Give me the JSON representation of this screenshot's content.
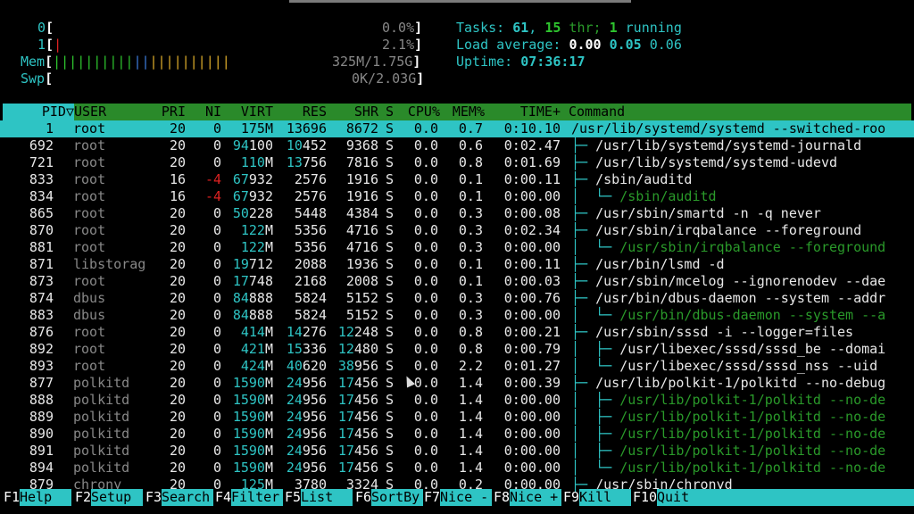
{
  "meters": {
    "cpu0": {
      "label": "0",
      "value": "0.0%"
    },
    "cpu1": {
      "label": "1",
      "value": "2.1%"
    },
    "mem": {
      "label": "Mem",
      "value": "325M/1.75G",
      "bar": "||||||||||||||||||||"
    },
    "swp": {
      "label": "Swp",
      "value": "0K/2.03G"
    }
  },
  "summary": {
    "tasks_label": "Tasks: ",
    "tasks": "61",
    "thr_count": "15",
    "thr_label": " thr; ",
    "running": "1",
    "running_label": " running",
    "load_label": "Load average: ",
    "load1": "0.00",
    "load5": "0.05",
    "load15": "0.06",
    "uptime_label": "Uptime: ",
    "uptime": "07:36:17"
  },
  "columns": {
    "pid": "PID▽",
    "user": "USER",
    "pri": "PRI",
    "ni": "NI",
    "virt": "VIRT",
    "res": "RES",
    "shr": "SHR",
    "s": "S",
    "cpu": "CPU%",
    "mem": "MEM%",
    "time": "TIME+",
    "cmd": "Command"
  },
  "processes": [
    {
      "pid": "1",
      "user": "root",
      "pri": "20",
      "ni": "0",
      "virt": "175M",
      "res": "13696",
      "shr": "8672",
      "s": "S",
      "cpu": "0.0",
      "mem": "0.7",
      "time": "0:10.10",
      "tree": "",
      "cmd": "/usr/lib/systemd/systemd --switched-roo",
      "thread": false
    },
    {
      "pid": "692",
      "user": "root",
      "pri": "20",
      "ni": "0",
      "virt": "94100",
      "res": "10452",
      "shr": "9368",
      "s": "S",
      "cpu": "0.0",
      "mem": "0.6",
      "time": "0:02.47",
      "tree": "├─ ",
      "cmd": "/usr/lib/systemd/systemd-journald",
      "thread": false
    },
    {
      "pid": "721",
      "user": "root",
      "pri": "20",
      "ni": "0",
      "virt": "110M",
      "res": "13756",
      "shr": "7816",
      "s": "S",
      "cpu": "0.0",
      "mem": "0.8",
      "time": "0:01.69",
      "tree": "├─ ",
      "cmd": "/usr/lib/systemd/systemd-udevd",
      "thread": false
    },
    {
      "pid": "833",
      "user": "root",
      "pri": "16",
      "ni": "-4",
      "virt": "67932",
      "res": "2576",
      "shr": "1916",
      "s": "S",
      "cpu": "0.0",
      "mem": "0.1",
      "time": "0:00.11",
      "tree": "├─ ",
      "cmd": "/sbin/auditd",
      "thread": false
    },
    {
      "pid": "834",
      "user": "root",
      "pri": "16",
      "ni": "-4",
      "virt": "67932",
      "res": "2576",
      "shr": "1916",
      "s": "S",
      "cpu": "0.0",
      "mem": "0.1",
      "time": "0:00.00",
      "tree": "│  └─ ",
      "cmd": "/sbin/auditd",
      "thread": true
    },
    {
      "pid": "865",
      "user": "root",
      "pri": "20",
      "ni": "0",
      "virt": "50228",
      "res": "5448",
      "shr": "4384",
      "s": "S",
      "cpu": "0.0",
      "mem": "0.3",
      "time": "0:00.08",
      "tree": "├─ ",
      "cmd": "/usr/sbin/smartd -n -q never",
      "thread": false
    },
    {
      "pid": "870",
      "user": "root",
      "pri": "20",
      "ni": "0",
      "virt": "122M",
      "res": "5356",
      "shr": "4716",
      "s": "S",
      "cpu": "0.0",
      "mem": "0.3",
      "time": "0:02.34",
      "tree": "├─ ",
      "cmd": "/usr/sbin/irqbalance --foreground",
      "thread": false
    },
    {
      "pid": "881",
      "user": "root",
      "pri": "20",
      "ni": "0",
      "virt": "122M",
      "res": "5356",
      "shr": "4716",
      "s": "S",
      "cpu": "0.0",
      "mem": "0.3",
      "time": "0:00.00",
      "tree": "│  └─ ",
      "cmd": "/usr/sbin/irqbalance --foreground",
      "thread": true
    },
    {
      "pid": "871",
      "user": "libstorag",
      "pri": "20",
      "ni": "0",
      "virt": "19712",
      "res": "2088",
      "shr": "1936",
      "s": "S",
      "cpu": "0.0",
      "mem": "0.1",
      "time": "0:00.11",
      "tree": "├─ ",
      "cmd": "/usr/bin/lsmd -d",
      "thread": false
    },
    {
      "pid": "873",
      "user": "root",
      "pri": "20",
      "ni": "0",
      "virt": "17748",
      "res": "2168",
      "shr": "2008",
      "s": "S",
      "cpu": "0.0",
      "mem": "0.1",
      "time": "0:00.03",
      "tree": "├─ ",
      "cmd": "/usr/sbin/mcelog --ignorenodev --dae",
      "thread": false
    },
    {
      "pid": "874",
      "user": "dbus",
      "pri": "20",
      "ni": "0",
      "virt": "84888",
      "res": "5824",
      "shr": "5152",
      "s": "S",
      "cpu": "0.0",
      "mem": "0.3",
      "time": "0:00.76",
      "tree": "├─ ",
      "cmd": "/usr/bin/dbus-daemon --system --addr",
      "thread": false
    },
    {
      "pid": "883",
      "user": "dbus",
      "pri": "20",
      "ni": "0",
      "virt": "84888",
      "res": "5824",
      "shr": "5152",
      "s": "S",
      "cpu": "0.0",
      "mem": "0.3",
      "time": "0:00.00",
      "tree": "│  └─ ",
      "cmd": "/usr/bin/dbus-daemon --system --a",
      "thread": true
    },
    {
      "pid": "876",
      "user": "root",
      "pri": "20",
      "ni": "0",
      "virt": "414M",
      "res": "14276",
      "shr": "12248",
      "s": "S",
      "cpu": "0.0",
      "mem": "0.8",
      "time": "0:00.21",
      "tree": "├─ ",
      "cmd": "/usr/sbin/sssd -i --logger=files",
      "thread": false
    },
    {
      "pid": "892",
      "user": "root",
      "pri": "20",
      "ni": "0",
      "virt": "421M",
      "res": "15336",
      "shr": "12480",
      "s": "S",
      "cpu": "0.0",
      "mem": "0.8",
      "time": "0:00.79",
      "tree": "│  ├─ ",
      "cmd": "/usr/libexec/sssd/sssd_be --domai",
      "thread": false
    },
    {
      "pid": "893",
      "user": "root",
      "pri": "20",
      "ni": "0",
      "virt": "424M",
      "res": "40620",
      "shr": "38956",
      "s": "S",
      "cpu": "0.0",
      "mem": "2.2",
      "time": "0:01.27",
      "tree": "│  └─ ",
      "cmd": "/usr/libexec/sssd/sssd_nss --uid",
      "thread": false
    },
    {
      "pid": "877",
      "user": "polkitd",
      "pri": "20",
      "ni": "0",
      "virt": "1590M",
      "res": "24956",
      "shr": "17456",
      "s": "S",
      "cpu": "0.0",
      "mem": "1.4",
      "time": "0:00.39",
      "tree": "├─ ",
      "cmd": "/usr/lib/polkit-1/polkitd --no-debug",
      "thread": false
    },
    {
      "pid": "888",
      "user": "polkitd",
      "pri": "20",
      "ni": "0",
      "virt": "1590M",
      "res": "24956",
      "shr": "17456",
      "s": "S",
      "cpu": "0.0",
      "mem": "1.4",
      "time": "0:00.00",
      "tree": "│  ├─ ",
      "cmd": "/usr/lib/polkit-1/polkitd --no-de",
      "thread": true
    },
    {
      "pid": "889",
      "user": "polkitd",
      "pri": "20",
      "ni": "0",
      "virt": "1590M",
      "res": "24956",
      "shr": "17456",
      "s": "S",
      "cpu": "0.0",
      "mem": "1.4",
      "time": "0:00.00",
      "tree": "│  ├─ ",
      "cmd": "/usr/lib/polkit-1/polkitd --no-de",
      "thread": true
    },
    {
      "pid": "890",
      "user": "polkitd",
      "pri": "20",
      "ni": "0",
      "virt": "1590M",
      "res": "24956",
      "shr": "17456",
      "s": "S",
      "cpu": "0.0",
      "mem": "1.4",
      "time": "0:00.00",
      "tree": "│  ├─ ",
      "cmd": "/usr/lib/polkit-1/polkitd --no-de",
      "thread": true
    },
    {
      "pid": "891",
      "user": "polkitd",
      "pri": "20",
      "ni": "0",
      "virt": "1590M",
      "res": "24956",
      "shr": "17456",
      "s": "S",
      "cpu": "0.0",
      "mem": "1.4",
      "time": "0:00.00",
      "tree": "│  ├─ ",
      "cmd": "/usr/lib/polkit-1/polkitd --no-de",
      "thread": true
    },
    {
      "pid": "894",
      "user": "polkitd",
      "pri": "20",
      "ni": "0",
      "virt": "1590M",
      "res": "24956",
      "shr": "17456",
      "s": "S",
      "cpu": "0.0",
      "mem": "1.4",
      "time": "0:00.00",
      "tree": "│  └─ ",
      "cmd": "/usr/lib/polkit-1/polkitd --no-de",
      "thread": true
    },
    {
      "pid": "879",
      "user": "chrony",
      "pri": "20",
      "ni": "0",
      "virt": "125M",
      "res": "3780",
      "shr": "3324",
      "s": "S",
      "cpu": "0.0",
      "mem": "0.2",
      "time": "0:00.00",
      "tree": "├─ ",
      "cmd": "/usr/sbin/chronyd",
      "thread": false
    }
  ],
  "footer": [
    {
      "key": "F1",
      "label": "Help  "
    },
    {
      "key": "F2",
      "label": "Setup "
    },
    {
      "key": "F3",
      "label": "Search"
    },
    {
      "key": "F4",
      "label": "Filter"
    },
    {
      "key": "F5",
      "label": "List  "
    },
    {
      "key": "F6",
      "label": "SortBy"
    },
    {
      "key": "F7",
      "label": "Nice -"
    },
    {
      "key": "F8",
      "label": "Nice +"
    },
    {
      "key": "F9",
      "label": "Kill  "
    },
    {
      "key": "F10",
      "label": "Quit  "
    }
  ],
  "colors": {
    "accent": "#2ec4c4",
    "header_bg": "#2a8a2a",
    "thread": "#2a9a2a",
    "negative": "#dd2222"
  }
}
